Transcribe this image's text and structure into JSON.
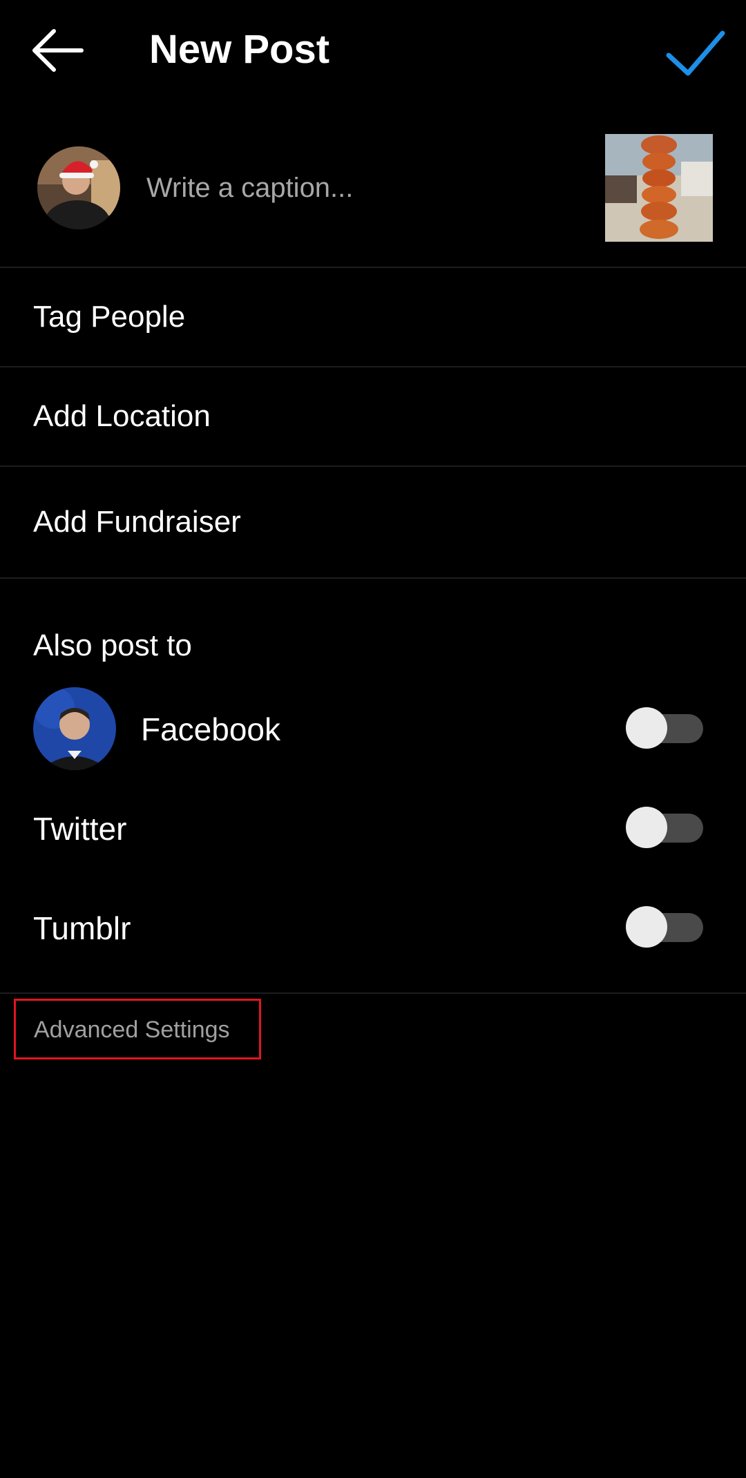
{
  "header": {
    "title": "New Post",
    "back_icon": "arrow-left-icon",
    "confirm_icon": "checkmark-icon",
    "accent_color": "#1d8fe8"
  },
  "caption": {
    "placeholder": "Write a caption..."
  },
  "menu": {
    "tag_people": "Tag People",
    "add_location": "Add Location",
    "add_fundraiser": "Add Fundraiser"
  },
  "share": {
    "section_label": "Also post to",
    "facebook": {
      "label": "Facebook",
      "enabled": false
    },
    "twitter": {
      "label": "Twitter",
      "enabled": false
    },
    "tumblr": {
      "label": "Tumblr",
      "enabled": false
    }
  },
  "advanced": {
    "label": "Advanced Settings",
    "highlight_color": "#e0161f"
  }
}
